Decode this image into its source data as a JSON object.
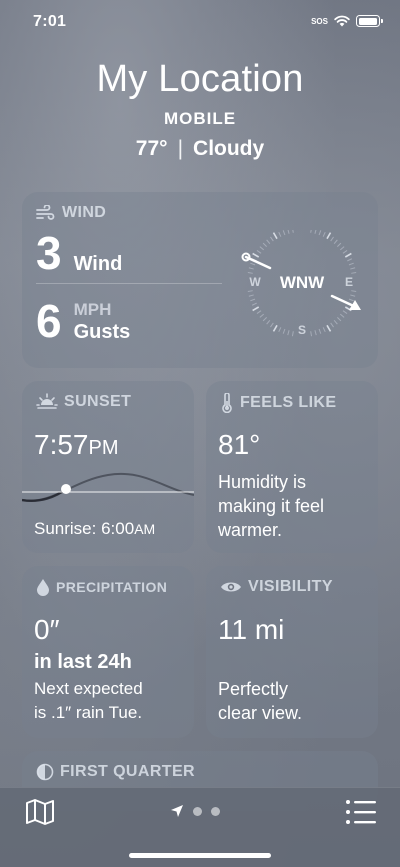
{
  "status_bar": {
    "time": "7:01",
    "sos": "SOS"
  },
  "header": {
    "title": "My Location",
    "subtitle": "MOBILE",
    "temperature": "77°",
    "separator": "|",
    "condition": "Cloudy"
  },
  "wind": {
    "heading": "WIND",
    "speed": "3",
    "speed_label": "Wind",
    "unit": "MPH",
    "gusts": "6",
    "gusts_label": "Gusts",
    "compass": {
      "direction": "WNW",
      "n": "",
      "e": "E",
      "s": "S",
      "w": "W"
    }
  },
  "sunset": {
    "heading": "SUNSET",
    "time": "7:57",
    "ampm": "PM",
    "sunrise_label": "Sunrise: 6:00",
    "sunrise_ampm": "AM"
  },
  "feels_like": {
    "heading": "FEELS LIKE",
    "value": "81°",
    "line1": "Humidity is",
    "line2": "making it feel",
    "line3": "warmer."
  },
  "precipitation": {
    "heading": "PRECIPITATION",
    "value": "0″",
    "period": "in last 24h",
    "line1": "Next expected",
    "line2": "is .1″ rain Tue."
  },
  "visibility": {
    "heading": "VISIBILITY",
    "value": "11 mi",
    "line1": "Perfectly",
    "line2": "clear view."
  },
  "moon": {
    "heading": "FIRST QUARTER"
  },
  "tab_bar": {
    "pages": 3,
    "current_page": 1
  },
  "colors": {
    "background": "#767c88",
    "card": "#7a8290",
    "text": "#ffffff",
    "muted": "#e1e6ee"
  }
}
